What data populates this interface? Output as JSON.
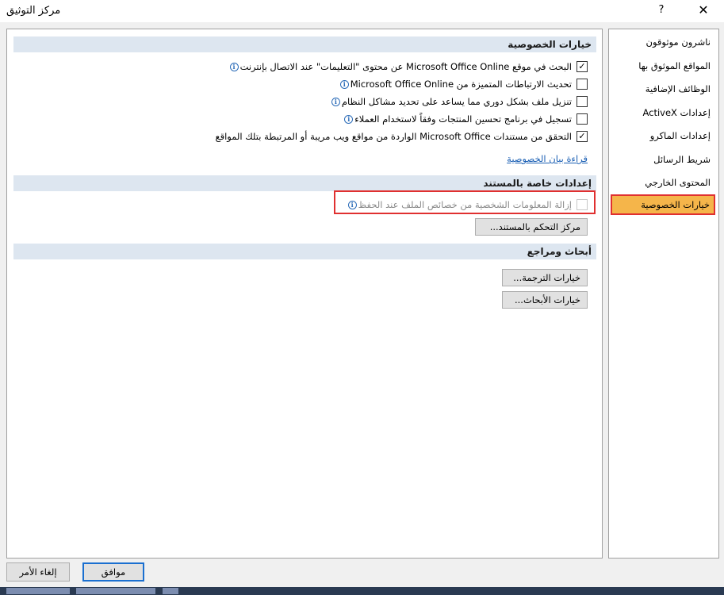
{
  "window": {
    "title": "مركز التوثيق",
    "help_glyph": "?",
    "close_glyph": "✕"
  },
  "sections": {
    "privacy": {
      "header": "خيارات الخصوصية",
      "options": [
        {
          "label": "البحث في موقع Microsoft Office Online عن محتوى \"التعليمات\" عند الاتصال بإنترنت",
          "checked": true
        },
        {
          "label": "تحديث الارتباطات المتميزة من Microsoft Office Online",
          "checked": false
        },
        {
          "label": "تنزيل ملف بشكل دوري مما يساعد على تحديد مشاكل النظام",
          "checked": false
        },
        {
          "label": "تسجيل في برنامج تحسين المنتجات وفقاً لاستخدام العملاء",
          "checked": false
        },
        {
          "label": "التحقق من مستندات Microsoft Office الواردة من مواقع ويب مريبة أو المرتبطة بتلك المواقع",
          "checked": true
        }
      ],
      "link": "قراءة بيان الخصوصية"
    },
    "document": {
      "header": "إعدادات خاصة بالمستند",
      "option": {
        "label": "إزالة المعلومات الشخصية من خصائص الملف عند الحفظ",
        "checked": false
      },
      "button": "مركز التحكم بالمستند..."
    },
    "research": {
      "header": "أبحاث ومراجع",
      "buttons": [
        "خيارات الترجمة...",
        "خيارات الأبحاث..."
      ]
    }
  },
  "sidebar": {
    "items": [
      {
        "label": "ناشرون موثوقون"
      },
      {
        "label": "المواقع الموثوق بها"
      },
      {
        "label": "الوظائف الإضافية"
      },
      {
        "label": "إعدادات ActiveX"
      },
      {
        "label": "إعدادات الماكرو"
      },
      {
        "label": "شريط الرسائل"
      },
      {
        "label": "المحتوى الخارجي"
      },
      {
        "label": "خيارات الخصوصية"
      }
    ],
    "active_index": 7
  },
  "footer": {
    "ok": "موافق",
    "cancel": "إلغاء الأمر"
  },
  "colors": {
    "accent": "#1a6fd0",
    "active_item": "#f5b54a",
    "highlight": "#e03030",
    "section_header": "#dde6f0"
  },
  "icons": {
    "info": "info-icon",
    "check": "checkmark-icon"
  }
}
